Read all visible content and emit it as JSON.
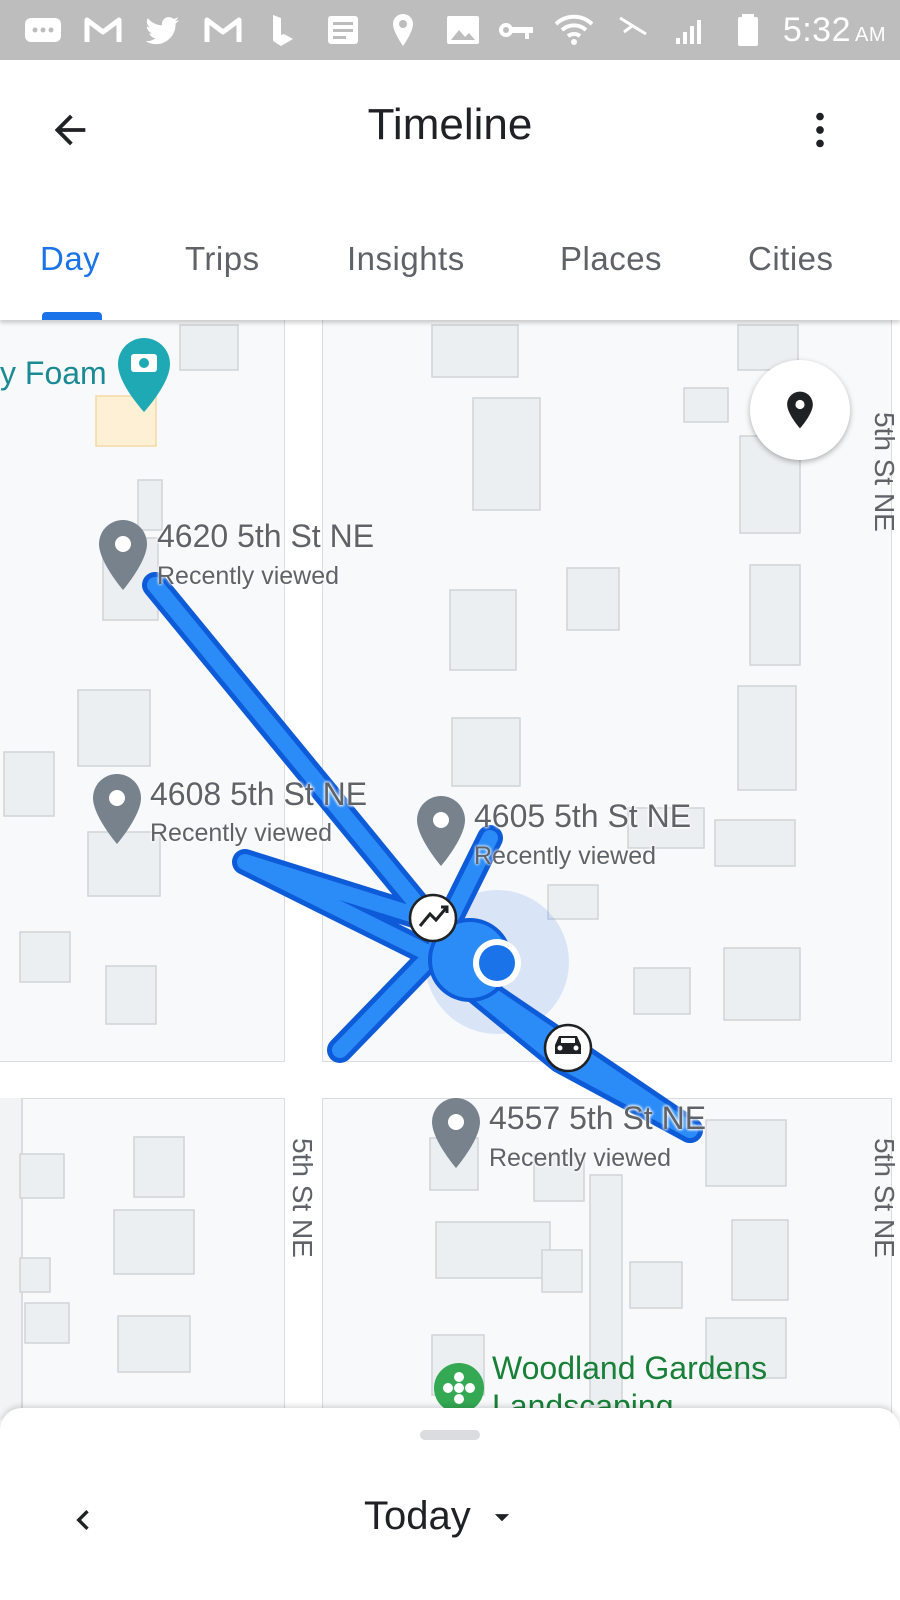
{
  "status_bar": {
    "time": "5:32",
    "ampm": "AM",
    "icons": [
      "messages-icon",
      "gmail-icon",
      "twitter-icon",
      "gmail-icon",
      "bing-icon",
      "news-icon",
      "location-icon",
      "image-icon",
      "vpn-key-icon",
      "wifi-icon",
      "airplane-icon",
      "signal-icon",
      "battery-icon"
    ]
  },
  "app_bar": {
    "title": "Timeline",
    "back_icon": "arrow-back-icon",
    "more_icon": "more-vert-icon"
  },
  "tabs": [
    {
      "label": "Day",
      "active": true
    },
    {
      "label": "Trips",
      "active": false
    },
    {
      "label": "Insights",
      "active": false
    },
    {
      "label": "Places",
      "active": false
    },
    {
      "label": "Cities",
      "active": false
    }
  ],
  "map": {
    "poi_top": "y Foam",
    "poi_bottom": "Woodland Gardens",
    "poi_bottom_line2": "Landscaping",
    "street_name": "5th St NE",
    "street_edge_top": "5th St NE",
    "street_edge_bottom": "5th St NE",
    "places": [
      {
        "name": "4620 5th St NE",
        "sub": "Recently viewed"
      },
      {
        "name": "4608 5th St NE",
        "sub": "Recently viewed"
      },
      {
        "name": "4605 5th St NE",
        "sub": "Recently viewed"
      },
      {
        "name": "4557 5th St NE",
        "sub": "Recently viewed"
      }
    ],
    "route_color": "#1a73e8",
    "my_location_icon": "place-pin-icon"
  },
  "bottom_sheet": {
    "day_label": "Today",
    "prev_icon": "chevron-left-icon",
    "dropdown_icon": "arrow-drop-down-icon"
  }
}
